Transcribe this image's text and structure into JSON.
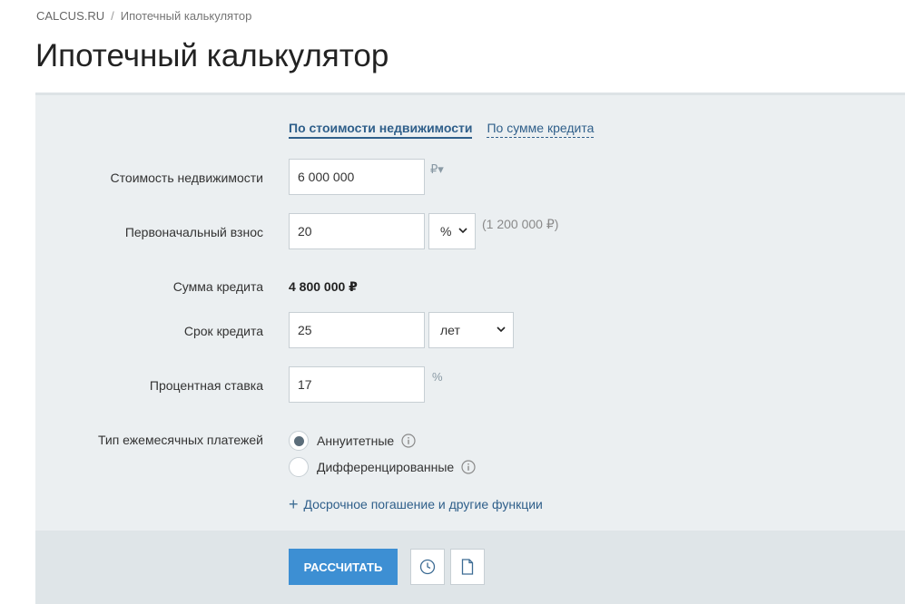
{
  "breadcrumb": {
    "home": "CALCUS.RU",
    "separator": "/",
    "current": "Ипотечный калькулятор"
  },
  "page_title": "Ипотечный калькулятор",
  "tabs": {
    "active": "По стоимости недвижимости",
    "other": "По сумме кредита"
  },
  "form": {
    "property_price": {
      "label": "Стоимость недвижимости",
      "value": "6 000 000",
      "currency": "₽▾"
    },
    "down_payment": {
      "label": "Первоначальный взнос",
      "value": "20",
      "unit": "%",
      "hint": "(1 200 000 ₽)"
    },
    "loan_amount": {
      "label": "Сумма кредита",
      "value": "4 800 000 ₽"
    },
    "term": {
      "label": "Срок кредита",
      "value": "25",
      "unit": "лет"
    },
    "rate": {
      "label": "Процентная ставка",
      "value": "17",
      "suffix": "%"
    },
    "payment_type": {
      "label": "Тип ежемесячных платежей",
      "options": [
        {
          "label": "Аннуитетные",
          "selected": true
        },
        {
          "label": "Дифференцированные",
          "selected": false
        }
      ]
    }
  },
  "more_link": "Досрочное погашение и другие функции",
  "buttons": {
    "calculate": "РАССЧИТАТЬ",
    "history_icon": "clock-icon",
    "document_icon": "document-icon"
  },
  "colors": {
    "accent": "#3d8fd3",
    "link": "#2f5f8a",
    "panel_bg": "#ebeff1"
  }
}
